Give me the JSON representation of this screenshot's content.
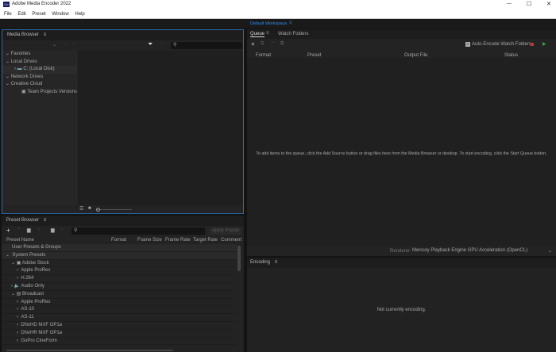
{
  "app": {
    "title": "Adobe Media Encoder 2022",
    "icon_label": "Me"
  },
  "menu": [
    "File",
    "Edit",
    "Preset",
    "Window",
    "Help"
  ],
  "window_controls": {
    "minimize": "—",
    "maximize": "☐",
    "close": "✕"
  },
  "workspace": {
    "label": "Default Workspace"
  },
  "media_browser": {
    "title": "Media Browser",
    "search_placeholder": "",
    "tree": [
      {
        "label": "Favorites"
      },
      {
        "label": "Local Drives"
      },
      {
        "label": "C: (Local Disk)"
      },
      {
        "label": "Network Drives"
      },
      {
        "label": "Creative Cloud"
      },
      {
        "label": "Team Projects Versions"
      }
    ]
  },
  "queue": {
    "tabs": [
      "Queue",
      "Watch Folders"
    ],
    "auto_encode_label": "Auto-Encode Watch Folders",
    "auto_encode_checked": true,
    "columns": [
      "Format",
      "Preset",
      "Output File",
      "Status"
    ],
    "empty_message": "To add items to the queue, click the Add Source button or drag files here from the Media Browser or desktop.  To start encoding, click the Start Queue button.",
    "renderer_label": "Renderer:",
    "renderer_value": "Mercury Playback Engine GPU Acceleration (OpenCL)"
  },
  "encoding": {
    "title": "Encoding",
    "status": "Not currently encoding."
  },
  "preset_browser": {
    "title": "Preset Browser",
    "apply_label": "Apply Preset",
    "columns": [
      "Preset Name",
      "Format",
      "Frame Size",
      "Frame Rate",
      "Target Rate",
      "Comment"
    ],
    "rows": [
      "User Presets & Groups",
      "System Presets",
      "Adobe Stock",
      "Apple ProRes",
      "H.264",
      "Audio Only",
      "Broadcast",
      "Apple ProRes",
      "AS-10",
      "AS-11",
      "DNxHD MXF OP1a",
      "DNxHR MXF OP1a",
      "GoPro CineForm"
    ]
  },
  "colors": {
    "accent": "#2d8ceb",
    "panel": "#232323",
    "stop": "#c8342c",
    "play": "#3aa64a"
  }
}
